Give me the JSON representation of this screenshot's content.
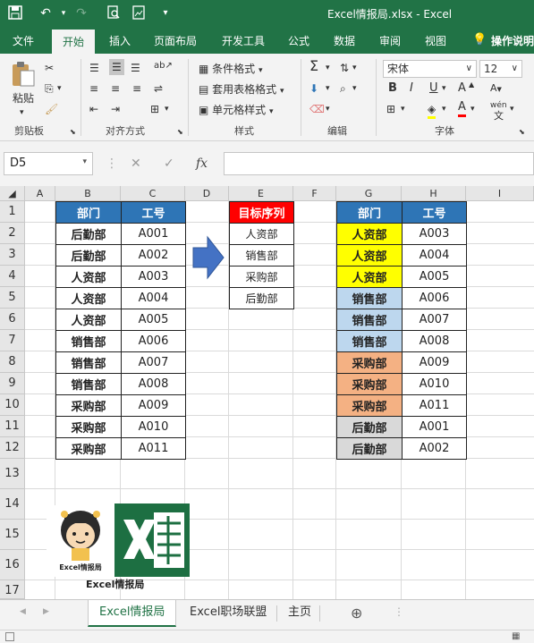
{
  "titlebar": {
    "doc_title": "Excel情报局.xlsx  -  Excel"
  },
  "ribbon_tabs": [
    "文件",
    "开始",
    "插入",
    "页面布局",
    "开发工具",
    "公式",
    "数据",
    "审阅",
    "视图",
    "操作说明"
  ],
  "ribbon": {
    "paste": "粘贴",
    "clipboard": "剪贴板",
    "alignment": "对齐方式",
    "cond_format": "条件格式",
    "table_format": "套用表格格式",
    "cell_style": "单元格样式",
    "styles": "样式",
    "editing": "编辑",
    "font_name": "宋体",
    "font_size": "12",
    "font": "字体",
    "bold": "B",
    "italic": "I",
    "underline": "U",
    "wen": "wén",
    "font_grow": "A",
    "font_color": "A"
  },
  "formula_bar": {
    "name_box": "D5",
    "fx": "fx",
    "cancel": "✕",
    "confirm": "✓"
  },
  "columns": [
    "A",
    "B",
    "C",
    "D",
    "E",
    "F",
    "G",
    "H",
    "I"
  ],
  "rows": [
    "1",
    "2",
    "3",
    "4",
    "5",
    "6",
    "7",
    "8",
    "9",
    "10",
    "11",
    "12",
    "13",
    "14",
    "15",
    "16",
    "17"
  ],
  "table1": {
    "headers": [
      "部门",
      "工号"
    ],
    "rows": [
      [
        "后勤部",
        "A001"
      ],
      [
        "后勤部",
        "A002"
      ],
      [
        "人资部",
        "A003"
      ],
      [
        "人资部",
        "A004"
      ],
      [
        "人资部",
        "A005"
      ],
      [
        "销售部",
        "A006"
      ],
      [
        "销售部",
        "A007"
      ],
      [
        "销售部",
        "A008"
      ],
      [
        "采购部",
        "A009"
      ],
      [
        "采购部",
        "A010"
      ],
      [
        "采购部",
        "A011"
      ]
    ]
  },
  "target": {
    "header": "目标序列",
    "items": [
      "人资部",
      "销售部",
      "采购部",
      "后勤部"
    ]
  },
  "table2": {
    "headers": [
      "部门",
      "工号"
    ],
    "rows": [
      [
        "人资部",
        "A003"
      ],
      [
        "人资部",
        "A004"
      ],
      [
        "人资部",
        "A005"
      ],
      [
        "销售部",
        "A006"
      ],
      [
        "销售部",
        "A007"
      ],
      [
        "销售部",
        "A008"
      ],
      [
        "采购部",
        "A009"
      ],
      [
        "采购部",
        "A010"
      ],
      [
        "采购部",
        "A011"
      ],
      [
        "后勤部",
        "A001"
      ],
      [
        "后勤部",
        "A002"
      ]
    ]
  },
  "colors": {
    "header_blue": "#2e75b6",
    "target_red": "#ff0000",
    "renzi": "#ffff00",
    "xiaoshou": "#bdd7ee",
    "caigou": "#f4b183",
    "houqin": "#d9d9d9",
    "excel_green": "#217346"
  },
  "logo": {
    "badge": "Excel情报局",
    "caption": "Excel情报局"
  },
  "sheet_tabs": [
    "Excel情报局",
    "Excel职场联盟",
    "主页"
  ],
  "sheet_add": "⊕"
}
